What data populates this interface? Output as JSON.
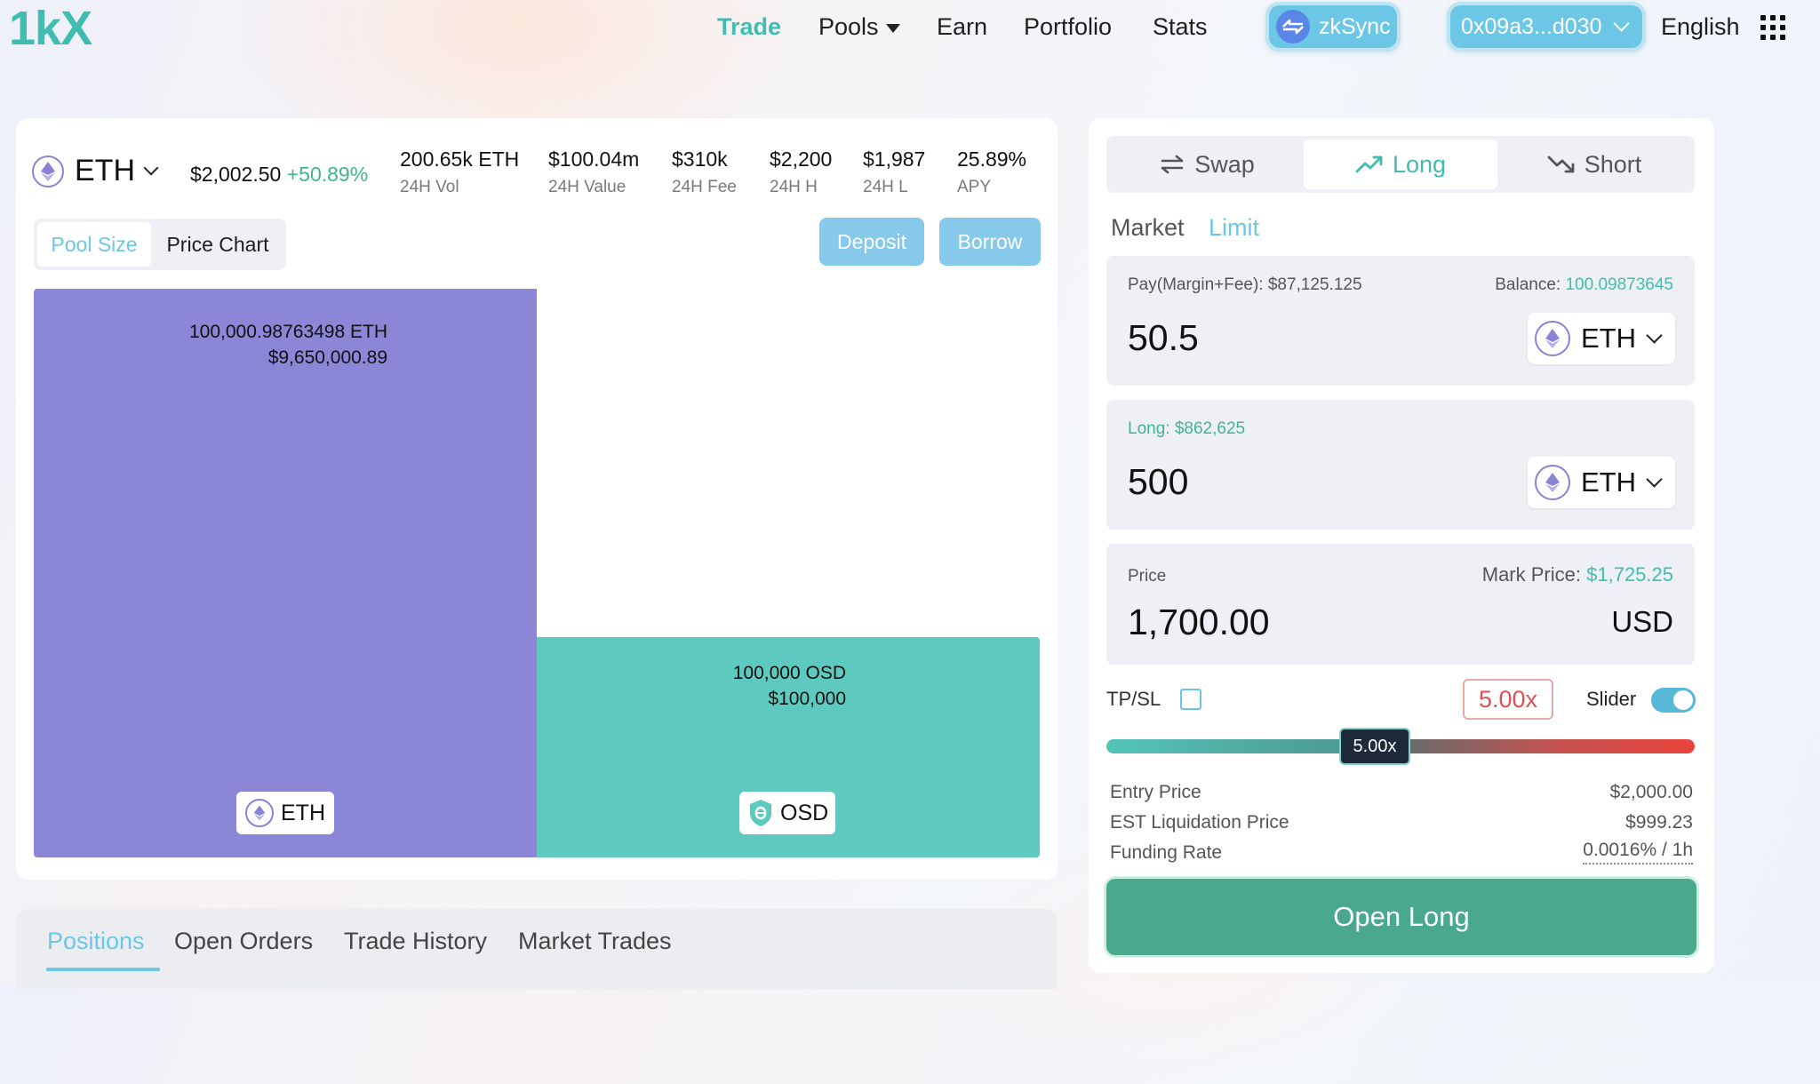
{
  "header": {
    "logo": "1kX",
    "nav": {
      "trade": "Trade",
      "pools": "Pools",
      "earn": "Earn",
      "portfolio": "Portfolio",
      "stats": "Stats"
    },
    "network_label": "zkSync",
    "wallet_address": "0x09a3...d030",
    "language": "English"
  },
  "market": {
    "symbol": "ETH",
    "price": "$2,002.50",
    "change": "+50.89%",
    "stats": [
      {
        "value": "200.65k ETH",
        "label": "24H Vol"
      },
      {
        "value": "$100.04m",
        "label": "24H Value"
      },
      {
        "value": "$310k",
        "label": "24H Fee"
      },
      {
        "value": "$2,200",
        "label": "24H H"
      },
      {
        "value": "$1,987",
        "label": "24H L"
      },
      {
        "value": "25.89%",
        "label": "APY"
      }
    ]
  },
  "view_tabs": {
    "pool_size": "Pool Size",
    "price_chart": "Price Chart"
  },
  "actions": {
    "deposit": "Deposit",
    "borrow": "Borrow"
  },
  "pool": {
    "eth": {
      "amount": "100,000.98763498 ETH",
      "usd": "$9,650,000.89",
      "token": "ETH",
      "color": "#8b86d6"
    },
    "osd": {
      "amount": "100,000 OSD",
      "usd": "$100,000",
      "token": "OSD",
      "color": "#5ecabf"
    }
  },
  "bottom_tabs": {
    "positions": "Positions",
    "open_orders": "Open Orders",
    "trade_history": "Trade History",
    "market_trades": "Market Trades"
  },
  "trade": {
    "tabs": {
      "swap": "Swap",
      "long": "Long",
      "short": "Short"
    },
    "order_types": {
      "market": "Market",
      "limit": "Limit"
    },
    "pay": {
      "label": "Pay(Margin+Fee): $87,125.125",
      "balance_label": "Balance:",
      "balance_value": "100.09873645",
      "amount": "50.5",
      "token": "ETH"
    },
    "long": {
      "label": "Long: $862,625",
      "amount": "500",
      "token": "ETH"
    },
    "price": {
      "label": "Price",
      "mark_label": "Mark Price:",
      "mark_value": "$1,725.25",
      "value": "1,700.00",
      "unit": "USD"
    },
    "tpsl_label": "TP/SL",
    "leverage": "5.00x",
    "slider_label": "Slider",
    "slider_thumb": "5.00x",
    "slider_level": 0.45,
    "info": [
      {
        "label": "Entry Price",
        "value": "$2,000.00"
      },
      {
        "label": "EST Liquidation Price",
        "value": "$999.23"
      },
      {
        "label": "Funding Rate",
        "value": "0.0016% / 1h"
      }
    ],
    "submit": "Open Long"
  },
  "colors": {
    "accent": "#3fbdb0",
    "positive": "#3fb58f",
    "negative": "#e05050",
    "button_blue": "#86c9ea",
    "open_long": "#4aa98c"
  }
}
